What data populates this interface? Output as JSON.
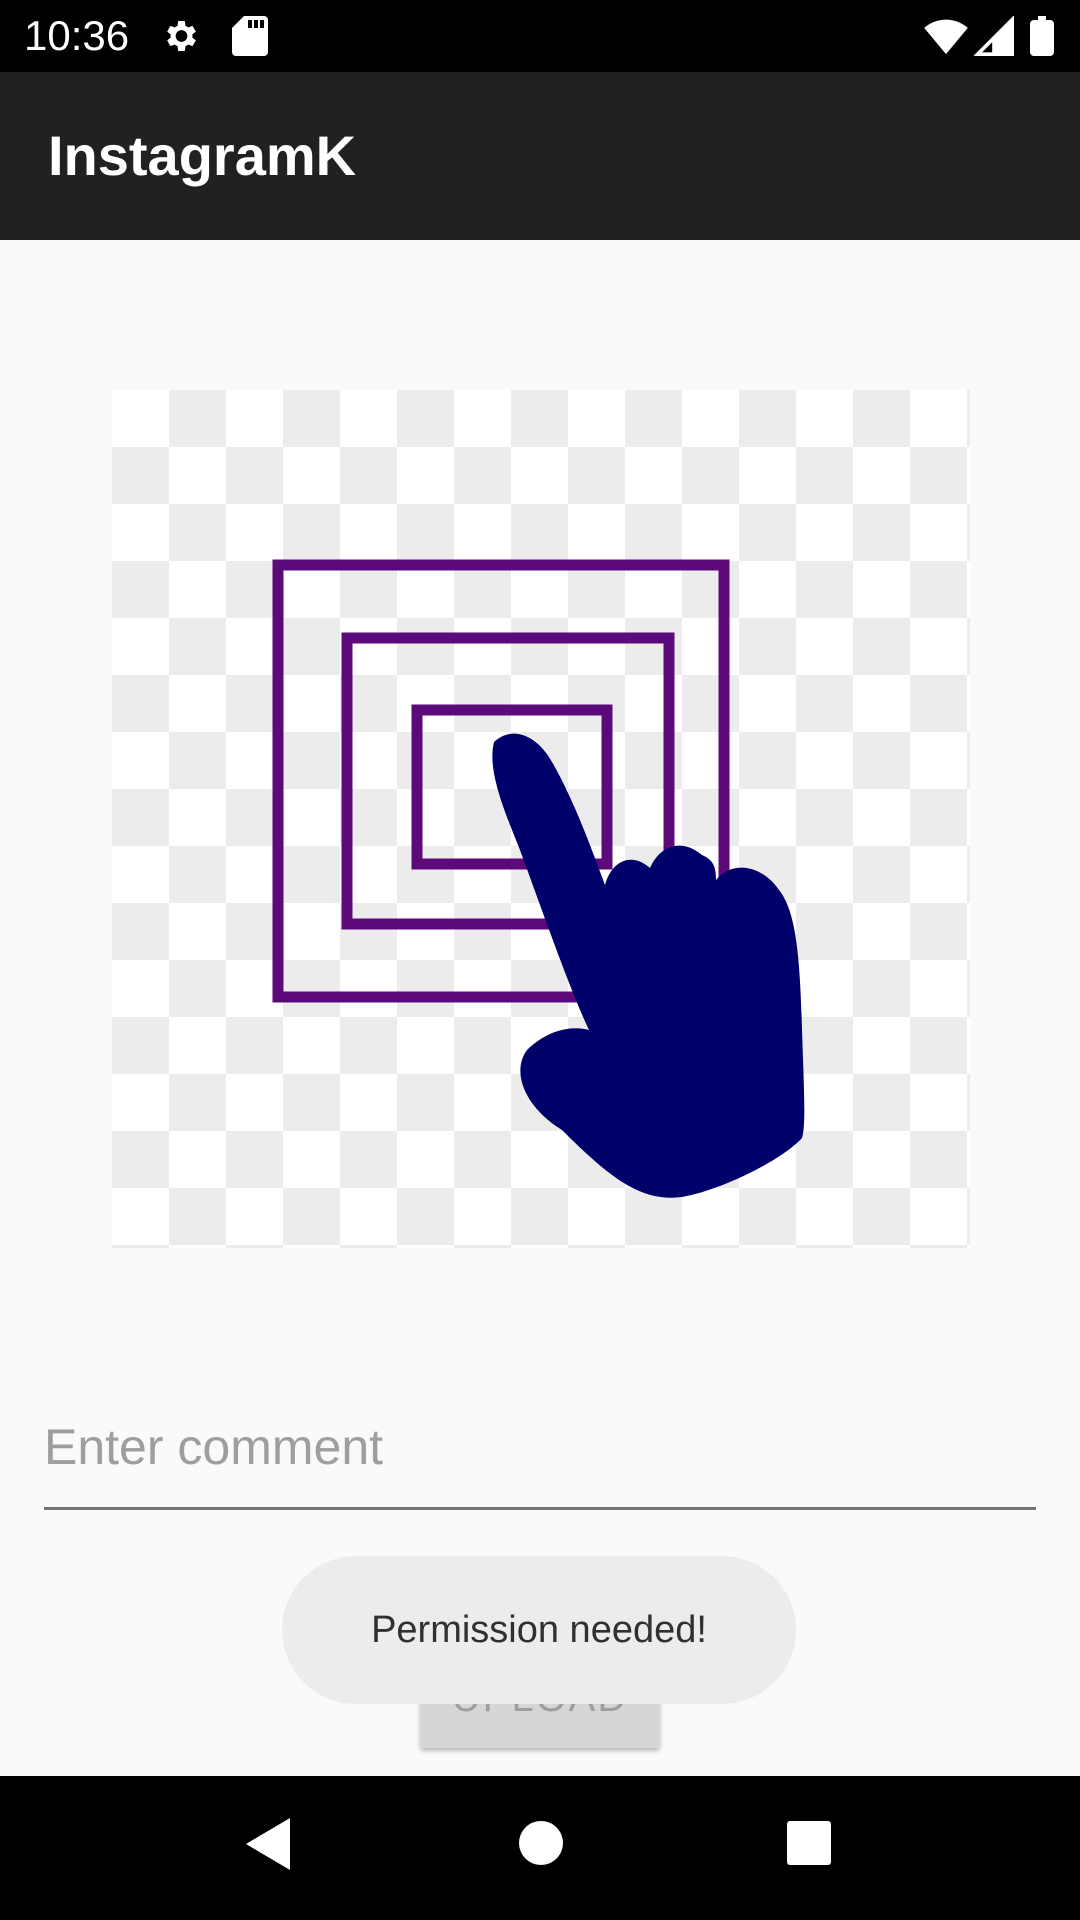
{
  "status_bar": {
    "time": "10:36",
    "left_icons": [
      "settings-icon",
      "sd-card-icon"
    ],
    "right_icons": [
      "wifi-icon",
      "signal-icon",
      "battery-icon"
    ]
  },
  "app_bar": {
    "title": "InstagramK"
  },
  "main": {
    "image_picker": {
      "icon": "touch-select-image-icon",
      "frame_color": "#5c0a7a",
      "hand_color": "#00006b"
    },
    "comment": {
      "placeholder": "Enter comment",
      "value": ""
    },
    "upload_label": "UPLOAD"
  },
  "toast": {
    "message": "Permission needed!"
  },
  "nav_bar": {
    "buttons": [
      "back-icon",
      "home-icon",
      "recents-icon"
    ]
  },
  "colors": {
    "status_bar": "#000000",
    "app_bar": "#212121",
    "background": "#fafafa",
    "toast": "#ececec"
  }
}
